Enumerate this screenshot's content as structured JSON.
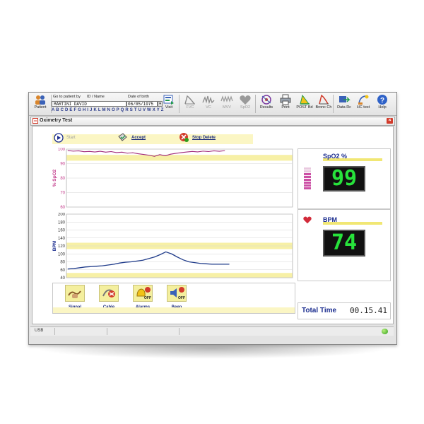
{
  "toolbar": {
    "patient_label": "Patient",
    "goto_label": "Go to patient by",
    "id_name_label": "ID / Name",
    "dob_label": "Date of birth",
    "patient_name": "MARTINI DAVID",
    "dob_value": "06/05/1975",
    "alphabet": "A B C D E F G H I J K L M N O P Q R S T U V W X Y Z",
    "buttons": {
      "visit": "Visit",
      "fvc": "FVC",
      "vc": "VC",
      "mvv": "MVV",
      "spo2": "SpO2",
      "results": "Results",
      "print": "Print",
      "post_bd": "POST Bd",
      "bronc_ch": "Bronc Ch",
      "data_rc": "Data Rc",
      "hc_test": "HC test",
      "help": "Help"
    }
  },
  "window": {
    "title": "Oximetry Test",
    "close": "×"
  },
  "actions": {
    "start": "Start",
    "accept": "Accept",
    "stop_delete": "Stop Delete"
  },
  "spo2_chart": {
    "ylabel": "% SpO2",
    "yticks": [
      "100",
      "90",
      "80",
      "70",
      "60"
    ]
  },
  "bpm_chart": {
    "ylabel": "BPM",
    "yticks": [
      "200",
      "180",
      "160",
      "140",
      "120",
      "100",
      "80",
      "60",
      "40"
    ]
  },
  "controls": {
    "signal": "Signal",
    "cable": "Cable",
    "alarms": "Alarms",
    "beep": "Beep",
    "alarms_state": "OFF",
    "beep_state": "OFF"
  },
  "readings": {
    "spo2_title": "SpO2  %",
    "spo2_value": "99",
    "bpm_title": "BPM",
    "bpm_value": "74",
    "total_time_label": "Total Time",
    "total_time_value": "00.15.41"
  },
  "status": {
    "usb": "USB"
  },
  "colors": {
    "accent_blue": "#1b2d8f",
    "highlight_yellow": "#f6ef9f",
    "lcd_green": "#27e33b",
    "spo2_trace": "#a0287a",
    "bpm_trace": "#1f3b8a"
  },
  "chart_data": [
    {
      "type": "line",
      "title": "",
      "xlabel": "",
      "ylabel": "% SpO2",
      "ylim": [
        60,
        100
      ],
      "series": [
        {
          "values": [
            99,
            98.6,
            98.8,
            98.2,
            98.4,
            98.0,
            98.5,
            97.9,
            98.3,
            97.6,
            97.9,
            97.2,
            97.5,
            96.8,
            96.3,
            95.8,
            95.0,
            96.2,
            95.4,
            96.5,
            97.1,
            97.6,
            98.0,
            98.4,
            98.1,
            98.6,
            98.3,
            98.8,
            98.5,
            98.9
          ]
        }
      ]
    },
    {
      "type": "line",
      "title": "",
      "xlabel": "",
      "ylabel": "BPM",
      "ylim": [
        40,
        200
      ],
      "series": [
        {
          "values": [
            62,
            63,
            65,
            67,
            68,
            69,
            70,
            72,
            74,
            77,
            79,
            80,
            82,
            84,
            88,
            92,
            98,
            105,
            100,
            92,
            85,
            80,
            78,
            76,
            75,
            74,
            74,
            74,
            74
          ]
        }
      ]
    }
  ]
}
